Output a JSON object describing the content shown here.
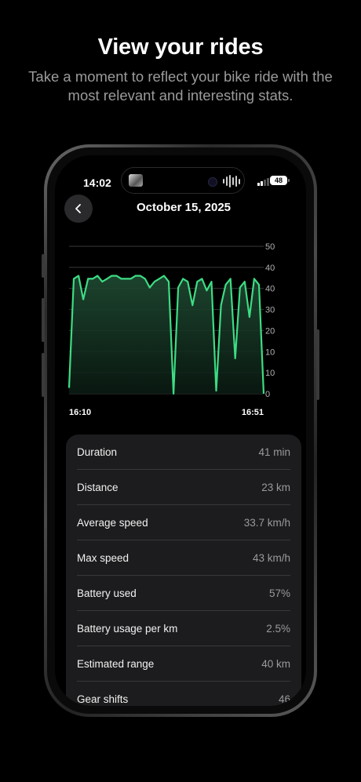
{
  "promo": {
    "headline": "View your rides",
    "subline": "Take a moment to reflect your bike ride with the most relevant and interesting stats."
  },
  "status_bar": {
    "time": "14:02",
    "battery": "48"
  },
  "nav": {
    "back_icon": "chevron-left-icon",
    "title": "October 15, 2025"
  },
  "colors": {
    "line": "#3ddc84",
    "card": "#1c1c1e"
  },
  "chart_data": {
    "type": "area",
    "x_start_label": "16:10",
    "x_end_label": "16:51",
    "y_ticks": [
      "50",
      "40",
      "40",
      "30",
      "20",
      "10",
      "10",
      "0"
    ],
    "ylim": [
      0,
      50
    ],
    "x": [
      0,
      1,
      2,
      3,
      4,
      5,
      6,
      7,
      8,
      9,
      10,
      11,
      12,
      13,
      14,
      15,
      16,
      17,
      18,
      19,
      20,
      21,
      22,
      23,
      24,
      25,
      26,
      27,
      28,
      29,
      30,
      31,
      32,
      33,
      34,
      35,
      36,
      37,
      38,
      39,
      40,
      41
    ],
    "values": [
      2,
      39,
      40,
      32,
      39,
      39,
      40,
      38,
      39,
      40,
      40,
      39,
      39,
      39,
      40,
      40,
      39,
      36,
      38,
      39,
      40,
      38,
      0,
      36,
      39,
      38,
      30,
      38,
      39,
      35,
      38,
      1,
      30,
      37,
      39,
      12,
      36,
      38,
      26,
      39,
      37,
      0
    ]
  },
  "stats": [
    {
      "label": "Duration",
      "value": "41 min"
    },
    {
      "label": "Distance",
      "value": "23 km"
    },
    {
      "label": "Average speed",
      "value": "33.7 km/h"
    },
    {
      "label": "Max speed",
      "value": "43 km/h"
    },
    {
      "label": "Battery used",
      "value": "57%"
    },
    {
      "label": "Battery usage per km",
      "value": "2.5%"
    },
    {
      "label": "Estimated range",
      "value": "40 km"
    },
    {
      "label": "Gear shifts",
      "value": "46"
    }
  ]
}
